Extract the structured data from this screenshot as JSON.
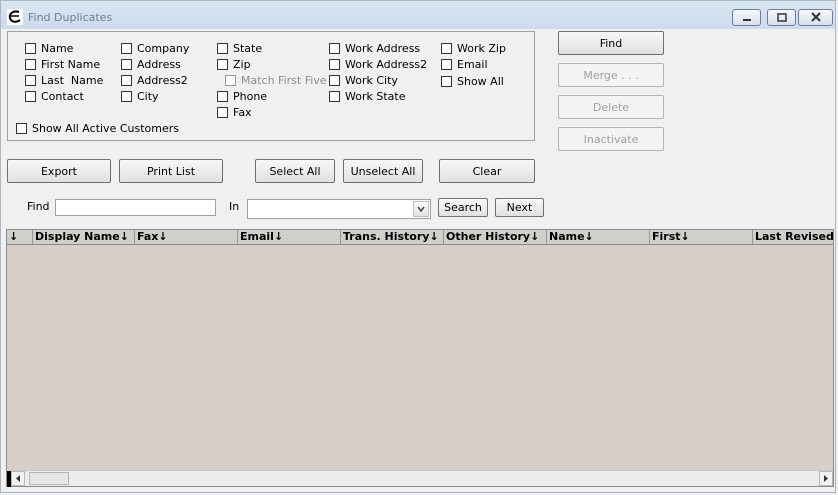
{
  "window": {
    "title": "Find Duplicates"
  },
  "checkboxes": {
    "col1": [
      "Name",
      "First Name",
      "Last  Name",
      "Contact"
    ],
    "col2": [
      "Company",
      "Address",
      "Address2",
      "City"
    ],
    "col3": [
      "State",
      "Zip",
      "Match First Five",
      "Phone",
      "Fax"
    ],
    "col4": [
      "Work Address",
      "Work Address2",
      "Work City",
      "Work State"
    ],
    "col5": [
      "Work Zip",
      "Email",
      "Show All"
    ],
    "active_customers": "Show All Active Customers"
  },
  "side_buttons": {
    "find": "Find",
    "merge": "Merge . . .",
    "delete": "Delete",
    "inactivate": "Inactivate"
  },
  "action_buttons": {
    "export": "Export",
    "print_list": "Print List",
    "select_all": "Select All",
    "unselect_all": "Unselect All",
    "clear": "Clear"
  },
  "search": {
    "find_label": "Find",
    "find_value": "",
    "in_label": "In",
    "in_value": "",
    "search_button": "Search",
    "next_button": "Next"
  },
  "grid": {
    "columns": [
      "↓",
      "Display Name↓",
      "Fax↓",
      "Email↓",
      "Trans. History↓",
      "Other History↓",
      "Name↓",
      "First↓",
      "Last Revised↓"
    ]
  },
  "colors": {
    "grid_body": "#d8cfc8",
    "titlebar": "#c9d8ea"
  }
}
